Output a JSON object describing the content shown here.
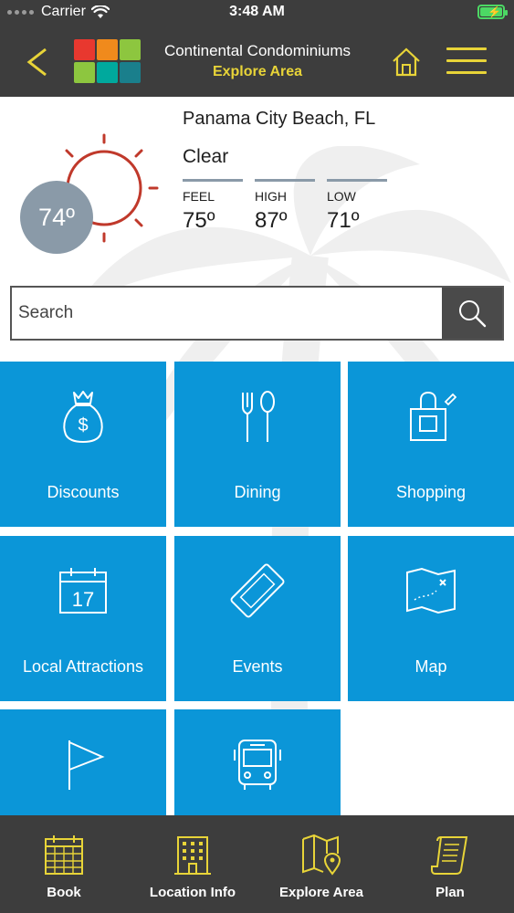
{
  "status_bar": {
    "carrier": "Carrier",
    "time": "3:48 AM"
  },
  "header": {
    "title": "Continental Condominiums",
    "subtitle": "Explore Area",
    "logo_colors": [
      "#e8382f",
      "#f08a1c",
      "#8dc63f",
      "#8dc63f",
      "#00a99d",
      "#1a7f8c"
    ],
    "accent": "#e8d438"
  },
  "weather": {
    "location": "Panama City Beach, FL",
    "condition": "Clear",
    "current_temp": "74º",
    "stats": [
      {
        "label": "FEEL",
        "value": "75º"
      },
      {
        "label": "HIGH",
        "value": "87º"
      },
      {
        "label": "LOW",
        "value": "71º"
      }
    ]
  },
  "search": {
    "placeholder": "Search"
  },
  "tiles": [
    {
      "label": "Discounts",
      "icon": "money-bag-icon"
    },
    {
      "label": "Dining",
      "icon": "fork-spoon-icon"
    },
    {
      "label": "Shopping",
      "icon": "shopping-bag-icon"
    },
    {
      "label": "Local Attractions",
      "icon": "calendar-icon",
      "icon_text": "17"
    },
    {
      "label": "Events",
      "icon": "ticket-icon"
    },
    {
      "label": "Map",
      "icon": "map-icon"
    },
    {
      "label": "",
      "icon": "flag-icon"
    },
    {
      "label": "",
      "icon": "bus-icon"
    }
  ],
  "tabbar": [
    {
      "label": "Book",
      "icon": "calendar-grid-icon"
    },
    {
      "label": "Location Info",
      "icon": "building-icon"
    },
    {
      "label": "Explore Area",
      "icon": "map-pin-icon"
    },
    {
      "label": "Plan",
      "icon": "scroll-icon"
    }
  ],
  "colors": {
    "tile_blue": "#0b96d8",
    "dark_bar": "#3d3d3d",
    "sun_red": "#c0392b"
  }
}
